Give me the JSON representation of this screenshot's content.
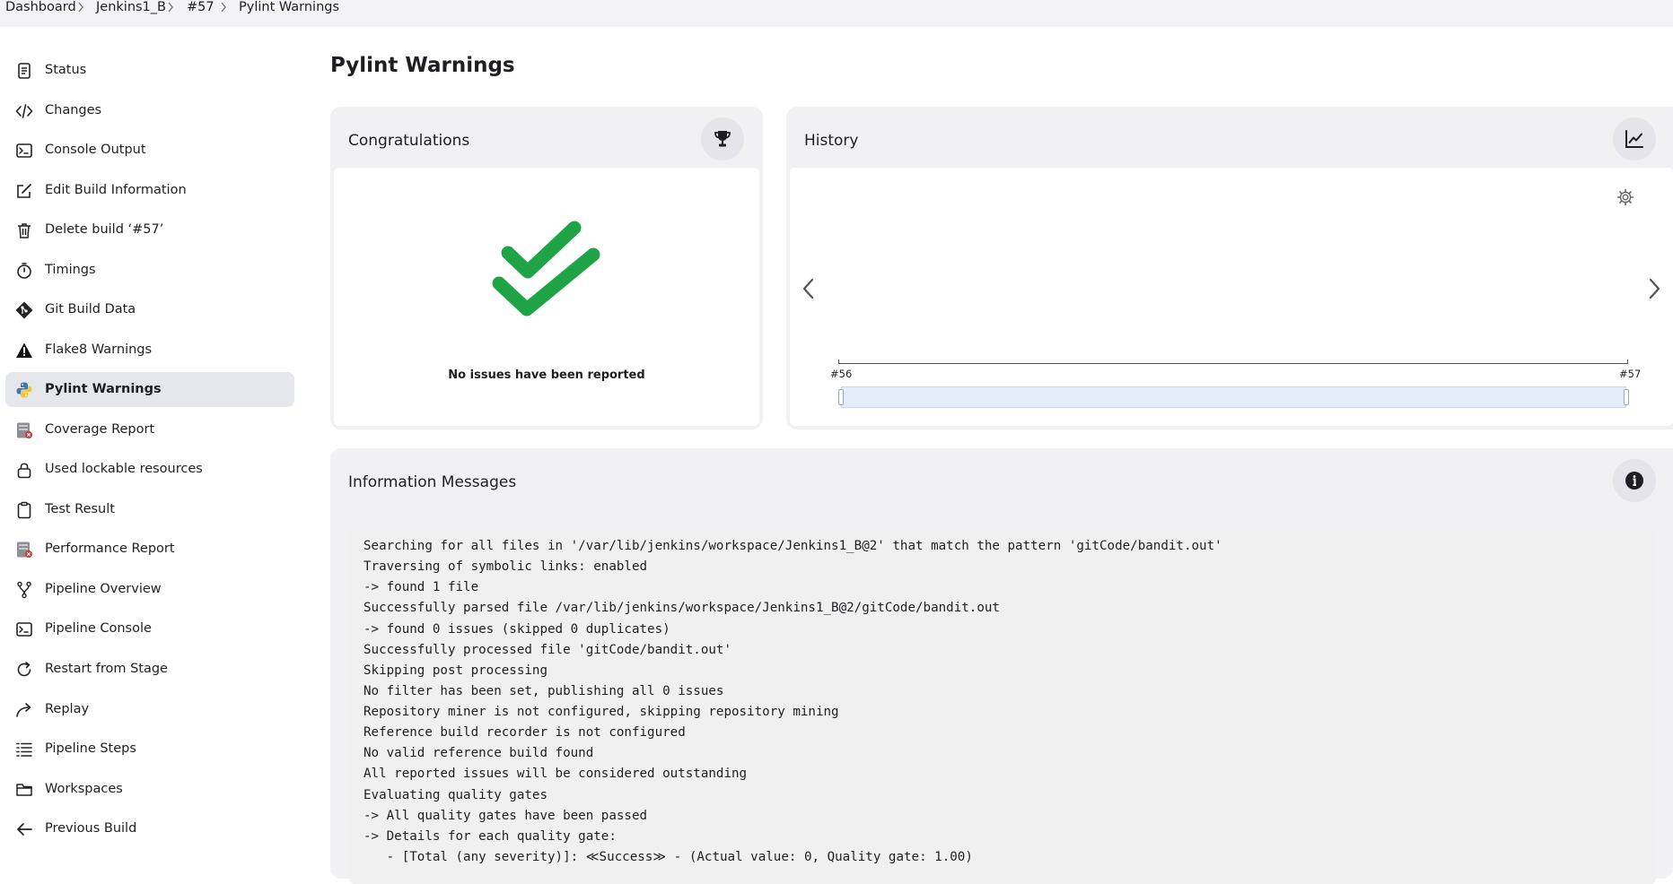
{
  "breadcrumb": {
    "items": [
      "Dashboard",
      "Jenkins1_B",
      "#57",
      "Pylint Warnings"
    ]
  },
  "sidebar": {
    "items": [
      {
        "label": "Status",
        "icon": "document-icon"
      },
      {
        "label": "Changes",
        "icon": "code-icon"
      },
      {
        "label": "Console Output",
        "icon": "terminal-icon"
      },
      {
        "label": "Edit Build Information",
        "icon": "edit-icon"
      },
      {
        "label": "Delete build ‘#57’",
        "icon": "trash-icon"
      },
      {
        "label": "Timings",
        "icon": "stopwatch-icon"
      },
      {
        "label": "Git Build Data",
        "icon": "git-icon"
      },
      {
        "label": "Flake8 Warnings",
        "icon": "warning-icon"
      },
      {
        "label": "Pylint Warnings",
        "icon": "python-icon",
        "active": true
      },
      {
        "label": "Coverage Report",
        "icon": "coverage-report-icon"
      },
      {
        "label": "Used lockable resources",
        "icon": "lock-icon"
      },
      {
        "label": "Test Result",
        "icon": "clipboard-icon"
      },
      {
        "label": "Performance Report",
        "icon": "performance-report-icon"
      },
      {
        "label": "Pipeline Overview",
        "icon": "branch-icon"
      },
      {
        "label": "Pipeline Console",
        "icon": "terminal-icon"
      },
      {
        "label": "Restart from Stage",
        "icon": "restart-icon"
      },
      {
        "label": "Replay",
        "icon": "replay-icon"
      },
      {
        "label": "Pipeline Steps",
        "icon": "list-icon"
      },
      {
        "label": "Workspaces",
        "icon": "folder-icon"
      },
      {
        "label": "Previous Build",
        "icon": "arrow-left-icon"
      }
    ]
  },
  "page": {
    "title": "Pylint Warnings"
  },
  "congrats": {
    "title": "Congratulations",
    "message": "No issues have been reported",
    "check_color": "#1ea446"
  },
  "history": {
    "title": "History",
    "range_start": "#56",
    "range_end": "#57"
  },
  "info": {
    "title": "Information Messages",
    "lines": [
      "Searching for all files in '/var/lib/jenkins/workspace/Jenkins1_B@2' that match the pattern 'gitCode/bandit.out'",
      "Traversing of symbolic links: enabled",
      "-> found 1 file",
      "Successfully parsed file /var/lib/jenkins/workspace/Jenkins1_B@2/gitCode/bandit.out",
      "-> found 0 issues (skipped 0 duplicates)",
      "Successfully processed file 'gitCode/bandit.out'",
      "Skipping post processing",
      "No filter has been set, publishing all 0 issues",
      "Repository miner is not configured, skipping repository mining",
      "Reference build recorder is not configured",
      "No valid reference build found",
      "All reported issues will be considered outstanding",
      "Evaluating quality gates",
      "-> All quality gates have been passed",
      "-> Details for each quality gate:",
      "   - [Total (any severity)]: ≪Success≫ - (Actual value: 0, Quality gate: 1.00)"
    ]
  },
  "colors": {
    "accent_success": "#1ea446",
    "active_bg": "#e6e6ed",
    "card_bg": "#f1f1f4"
  }
}
